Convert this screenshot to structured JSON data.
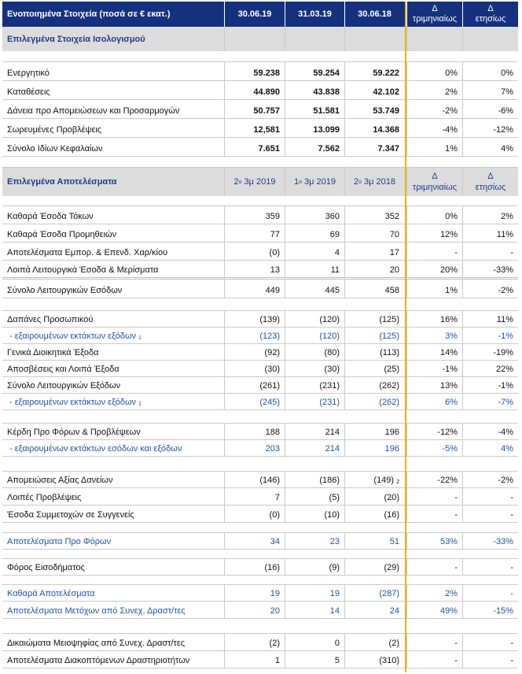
{
  "header": {
    "title": "Ενοποιημένα Στοιχεία (ποσά σε € εκατ.)",
    "cols": [
      "30.06.19",
      "31.03.19",
      "30.06.18"
    ],
    "delta_q": [
      "Δ",
      "τριμηνιαίως"
    ],
    "delta_y": [
      "Δ",
      "ετησίως"
    ]
  },
  "balance": {
    "title": "Επιλεγμένα Στοιχεία Ισολογισμού",
    "rows": [
      {
        "label": "Ενεργητικό",
        "v1": "59.238",
        "v2": "59.254",
        "v3": "59.222",
        "q": "0%",
        "y": "0%"
      },
      {
        "label": "Καταθέσεις",
        "v1": "44.890",
        "v2": "43.838",
        "v3": "42.102",
        "q": "2%",
        "y": "7%"
      },
      {
        "label": "Δάνεια προ Απομειώσεων και Προσαρμογών",
        "v1": "50.757",
        "v2": "51.581",
        "v3": "53.749",
        "q": "-2%",
        "y": "-6%"
      },
      {
        "label": "Σωρευμένες Προβλέψεις",
        "v1": "12,581",
        "v2": "13.099",
        "v3": "14.368",
        "q": "-4%",
        "y": "-12%"
      },
      {
        "label": "Σύνολο Ιδίων Κεφαλαίων",
        "v1": "7.651",
        "v2": "7.562",
        "v3": "7.347",
        "q": "1%",
        "y": "4%"
      }
    ]
  },
  "results": {
    "title": "Επιλεγμένα Αποτελέσματα",
    "cols": [
      {
        "a": "2",
        "b": "ο",
        "c": " 3μ 2019"
      },
      {
        "a": "1",
        "b": "ο",
        "c": " 3μ 2019"
      },
      {
        "a": "2",
        "b": "ο",
        "c": " 3μ 2018"
      }
    ],
    "delta_q": [
      "Δ",
      "τριμηνιαίως"
    ],
    "delta_y": [
      "Δ",
      "ετησίως"
    ],
    "rows": [
      {
        "label": "Καθαρά Έσοδα Τόκων",
        "v1": "359",
        "v2": "360",
        "v3": "352",
        "q": "0%",
        "y": "2%"
      },
      {
        "label": "Καθαρά Έσοδα Προμηθειών",
        "v1": "77",
        "v2": "69",
        "v3": "70",
        "q": "12%",
        "y": "11%"
      },
      {
        "label": "Αποτελέσματα Εμπορ. & Επενδ. Χαρ/κίου",
        "v1": "(0)",
        "v2": "4",
        "v3": "17",
        "q": "-",
        "y": "-"
      },
      {
        "label": "Λοιπά Λειτουργικά Έσοδα & Μερίσματα",
        "v1": "13",
        "v2": "11",
        "v3": "20",
        "q": "20%",
        "y": "-33%"
      },
      {
        "label": "Σύνολο Λειτουργικών Εσόδων",
        "v1": "449",
        "v2": "445",
        "v3": "458",
        "q": "1%",
        "y": "-2%"
      },
      {
        "label": "Δαπάνες Προσωπικού",
        "v1": "(139)",
        "v2": "(120)",
        "v3": "(125)",
        "q": "16%",
        "y": "11%"
      },
      {
        "label": " - εξαιρουμένων εκτάκτων εξόδων",
        "sup": "1",
        "v1": "(123)",
        "v2": "(120)",
        "v3": "(125)",
        "q": "3%",
        "y": "-1%"
      },
      {
        "label": "Γενικά Διοικητικά Έξοδα",
        "v1": "(92)",
        "v2": "(80)",
        "v3": "(113)",
        "q": "14%",
        "y": "-19%"
      },
      {
        "label": "Αποσβέσεις και Λοιπά Έξοδα",
        "v1": "(30)",
        "v2": "(30)",
        "v3": "(25)",
        "q": "-1%",
        "y": "22%"
      },
      {
        "label": "Σύνολο Λειτουργικών Εξόδων",
        "v1": "(261)",
        "v2": "(231)",
        "v3": "(262)",
        "q": "13%",
        "y": "-1%"
      },
      {
        "label": " - εξαιρουμένων εκτάκτων εξόδων",
        "sup": "1",
        "v1": "(245)",
        "v2": "(231)",
        "v3": "(262)",
        "q": "6%",
        "y": "-7%"
      },
      {
        "label": "Κέρδη Προ Φόρων & Προβλέψεων",
        "v1": "188",
        "v2": "214",
        "v3": "196",
        "q": "-12%",
        "y": "-4%"
      },
      {
        "label": " - εξαιρουμένων εκτάκτων εσόδων και εξόδων",
        "v1": "203",
        "v2": "214",
        "v3": "196",
        "q": "-5%",
        "y": "4%"
      },
      {
        "label": "Απομειώσεις Αξίας Δανείων",
        "v1": "(146)",
        "v2": "(186)",
        "v3": "(149)",
        "v3sup": "2",
        "q": "-22%",
        "y": "-2%"
      },
      {
        "label": "Λοιπές Προβλέψεις",
        "v1": "7",
        "v2": "(5)",
        "v3": "(20)",
        "q": "-",
        "y": "-"
      },
      {
        "label": "Έσοδα Συμμετοχών σε Συγγενείς",
        "v1": "(0)",
        "v2": "(10)",
        "v3": "(16)",
        "q": "-",
        "y": "-"
      },
      {
        "label": "Αποτελέσματα Προ Φόρων",
        "v1": "34",
        "v2": "23",
        "v3": "51",
        "q": "53%",
        "y": "-33%"
      },
      {
        "label": "Φόρος Εισοδήματος",
        "v1": "(16)",
        "v2": "(9)",
        "v3": "(29)",
        "q": "-",
        "y": "-"
      },
      {
        "label": "Καθαρά Αποτελέσματα",
        "v1": "19",
        "v2": "19",
        "v3": "(287)",
        "q": "2%",
        "y": "-"
      },
      {
        "label": "Αποτελέσματα Μετόχων από Συνεχ. Δραστ/τες",
        "v1": "20",
        "v2": "14",
        "v3": "24",
        "q": "49%",
        "y": "-15%"
      },
      {
        "label": "Δικαιώματα Μειοψηφίας από Συνεχ. Δραστ/τες",
        "v1": "(2)",
        "v2": "0",
        "v3": "(2)",
        "q": "-",
        "y": "-"
      },
      {
        "label": "Αποτελέσματα Διακοπτόμενων Δραστηριοτήτων",
        "v1": "1",
        "v2": "5",
        "v3": "(310)",
        "q": "-",
        "y": "-"
      }
    ]
  },
  "colors": {
    "header_bg": "#15317e",
    "section_bg": "#dcdcdc",
    "section_text": "#1f3d8a",
    "highlight_blue": "#1f52a6",
    "gold_line": "#e8b400"
  }
}
